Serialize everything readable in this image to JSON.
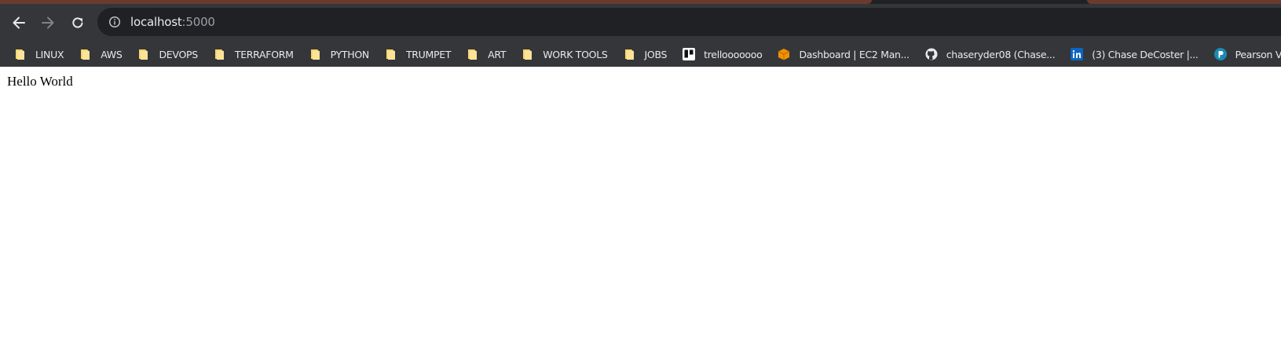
{
  "browser": {
    "address_bar": {
      "host": "localhost",
      "port": ":5000"
    },
    "colors": {
      "toolbar_bg": "#35363a",
      "omnibox_bg": "#202124",
      "tab_strip": "#6b3a2e",
      "folder": "#f6d86b"
    },
    "bookmarks": [
      {
        "label": "LINUX",
        "icon": "folder-icon"
      },
      {
        "label": "AWS",
        "icon": "folder-icon"
      },
      {
        "label": "DEVOPS",
        "icon": "folder-icon"
      },
      {
        "label": "TERRAFORM",
        "icon": "folder-icon"
      },
      {
        "label": "PYTHON",
        "icon": "folder-icon"
      },
      {
        "label": "TRUMPET",
        "icon": "folder-icon"
      },
      {
        "label": "ART",
        "icon": "folder-icon"
      },
      {
        "label": "WORK TOOLS",
        "icon": "folder-icon"
      },
      {
        "label": "JOBS",
        "icon": "folder-icon"
      },
      {
        "label": "trellooooooo",
        "icon": "trello-icon"
      },
      {
        "label": "Dashboard | EC2 Man...",
        "icon": "aws-box-icon"
      },
      {
        "label": "chaseryder08 (Chase...",
        "icon": "github-icon"
      },
      {
        "label": "(3) Chase DeCoster |...",
        "icon": "linkedin-icon"
      },
      {
        "label": "Pearson VUE - It's tim...",
        "icon": "pearson-icon"
      }
    ]
  },
  "page": {
    "body_text": "Hello World"
  }
}
